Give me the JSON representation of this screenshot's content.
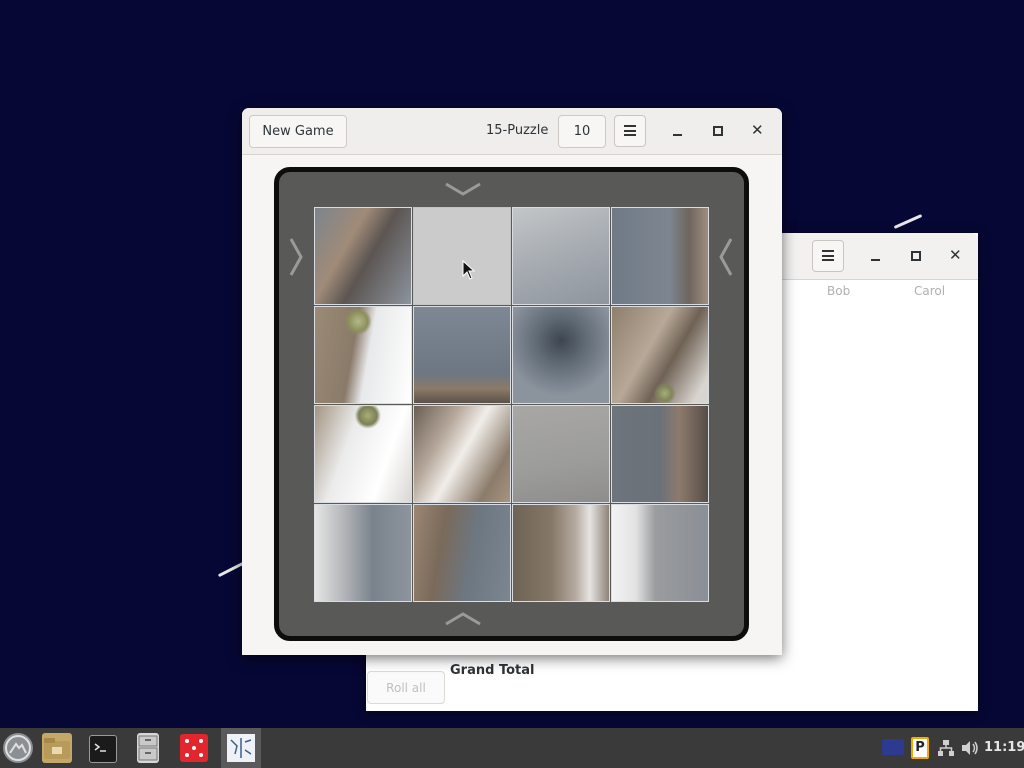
{
  "puzzle_window": {
    "new_game_label": "New Game",
    "title": "15-Puzzle",
    "size_value": "10",
    "board_grid": "4x4",
    "empty_tile": {
      "row": 1,
      "col": 2
    }
  },
  "scores_window": {
    "columns": [
      "Bob",
      "Carol"
    ],
    "grand_total_label": "Grand Total",
    "roll_all_label": "Roll all"
  },
  "icons": {
    "menu": "hamburger-menu-icon",
    "minimize": "minimize-icon",
    "maximize": "maximize-icon",
    "close": "close-icon",
    "slide_up": "chevron-down-icon",
    "slide_down": "chevron-up-icon",
    "slide_left": "chevron-right-icon",
    "slide_right": "chevron-left-icon"
  },
  "taskbar": {
    "apps": [
      "app-menu",
      "file-manager",
      "terminal",
      "archive-manager",
      "dice-game",
      "puzzle-game"
    ],
    "tray": [
      "keyboard-layout-icon",
      "pager-icon",
      "network-icon",
      "volume-icon"
    ],
    "clock": "11:19"
  },
  "colors": {
    "desktop": "#070735",
    "board": "#595958",
    "board_border": "#0d0d0d",
    "taskbar": "#3a3a3a",
    "empty_tile": "#cbcbcb"
  }
}
